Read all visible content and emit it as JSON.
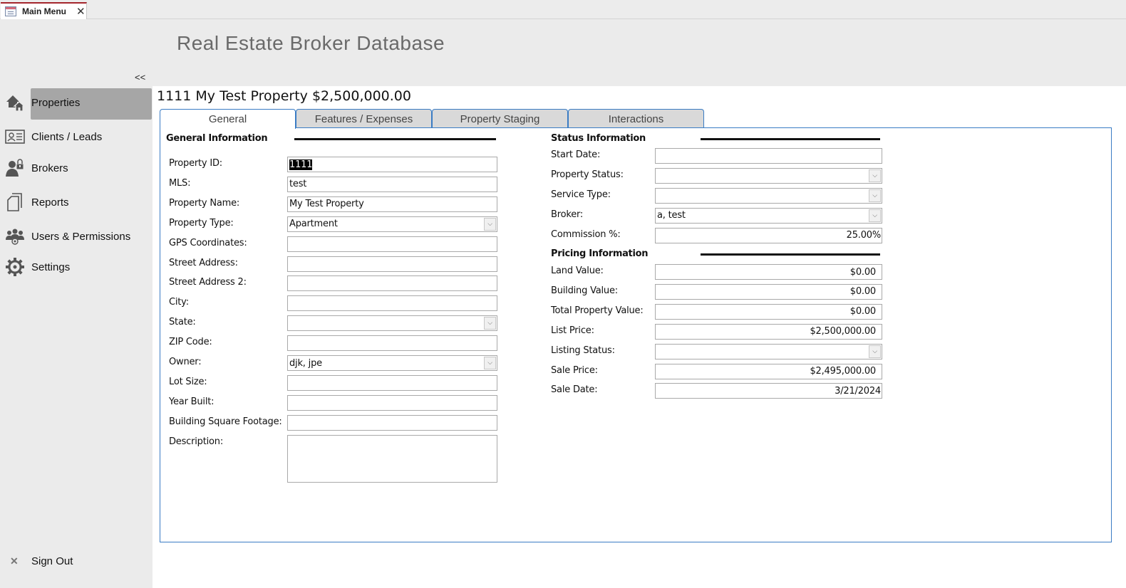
{
  "window": {
    "tab_label": "Main Menu",
    "tab_icon": "form-icon",
    "close_icon": "close-icon"
  },
  "header": {
    "app_title": "Real Estate Broker Database",
    "collapse_label": "<<"
  },
  "sidebar": {
    "items": [
      {
        "label": "Properties",
        "icon": "house-icon",
        "active": true
      },
      {
        "label": "Clients / Leads",
        "icon": "contact-card-icon",
        "active": false
      },
      {
        "label": "Brokers",
        "icon": "broker-lock-icon",
        "active": false
      },
      {
        "label": "Reports",
        "icon": "documents-icon",
        "active": false
      },
      {
        "label": "Users & Permissions",
        "icon": "users-group-icon",
        "active": false
      },
      {
        "label": "Settings",
        "icon": "gear-icon",
        "active": false
      }
    ],
    "signout": {
      "label": "Sign Out",
      "icon": "x-icon"
    }
  },
  "record": {
    "title": "1111 My Test Property $2,500,000.00"
  },
  "tabs": [
    {
      "label": "General",
      "active": true
    },
    {
      "label": "Features / Expenses",
      "active": false
    },
    {
      "label": "Property Staging",
      "active": false
    },
    {
      "label": "Interactions",
      "active": false
    }
  ],
  "general": {
    "heading": "General Information",
    "fields": [
      {
        "label": "Property ID:",
        "value": "1111",
        "type": "text",
        "selected": true
      },
      {
        "label": "MLS:",
        "value": "test",
        "type": "text"
      },
      {
        "label": "Property Name:",
        "value": "My Test Property",
        "type": "text"
      },
      {
        "label": "Property Type:",
        "value": "Apartment",
        "type": "combo"
      },
      {
        "label": "GPS Coordinates:",
        "value": "",
        "type": "text"
      },
      {
        "label": "Street Address:",
        "value": "",
        "type": "text"
      },
      {
        "label": "Street Address 2:",
        "value": "",
        "type": "text"
      },
      {
        "label": "City:",
        "value": "",
        "type": "text"
      },
      {
        "label": "State:",
        "value": "",
        "type": "combo"
      },
      {
        "label": "ZIP Code:",
        "value": "",
        "type": "text"
      },
      {
        "label": "Owner:",
        "value": "djk, jpe",
        "type": "combo"
      },
      {
        "label": "Lot Size:",
        "value": "",
        "type": "text"
      },
      {
        "label": "Year Built:",
        "value": "",
        "type": "text"
      },
      {
        "label": "Building Square Footage:",
        "value": "",
        "type": "text"
      },
      {
        "label": "Description:",
        "value": "",
        "type": "memo"
      }
    ]
  },
  "status": {
    "heading": "Status Information",
    "fields": [
      {
        "label": "Start Date:",
        "value": "",
        "type": "text"
      },
      {
        "label": "Property Status:",
        "value": "",
        "type": "combo"
      },
      {
        "label": "Service Type:",
        "value": "",
        "type": "combo"
      },
      {
        "label": "Broker:",
        "value": "a, test",
        "type": "combo"
      },
      {
        "label": "Commission %:",
        "value": "25.00%",
        "type": "number"
      }
    ]
  },
  "pricing": {
    "heading": "Pricing Information",
    "fields": [
      {
        "label": "Land Value:",
        "value": "$0.00",
        "type": "number"
      },
      {
        "label": "Building Value:",
        "value": "$0.00",
        "type": "number"
      },
      {
        "label": "Total Property Value:",
        "value": "$0.00",
        "type": "number"
      },
      {
        "label": "List Price:",
        "value": "$2,500,000.00",
        "type": "number"
      },
      {
        "label": "Listing Status:",
        "value": "",
        "type": "combo"
      },
      {
        "label": "Sale Price:",
        "value": "$2,495,000.00",
        "type": "number"
      },
      {
        "label": "Sale Date:",
        "value": "3/21/2024",
        "type": "date"
      }
    ]
  },
  "colors": {
    "tab_border": "#3a7cc4",
    "doc_tab_accent": "#a4262c",
    "active_nav": "#a6a6a6"
  }
}
